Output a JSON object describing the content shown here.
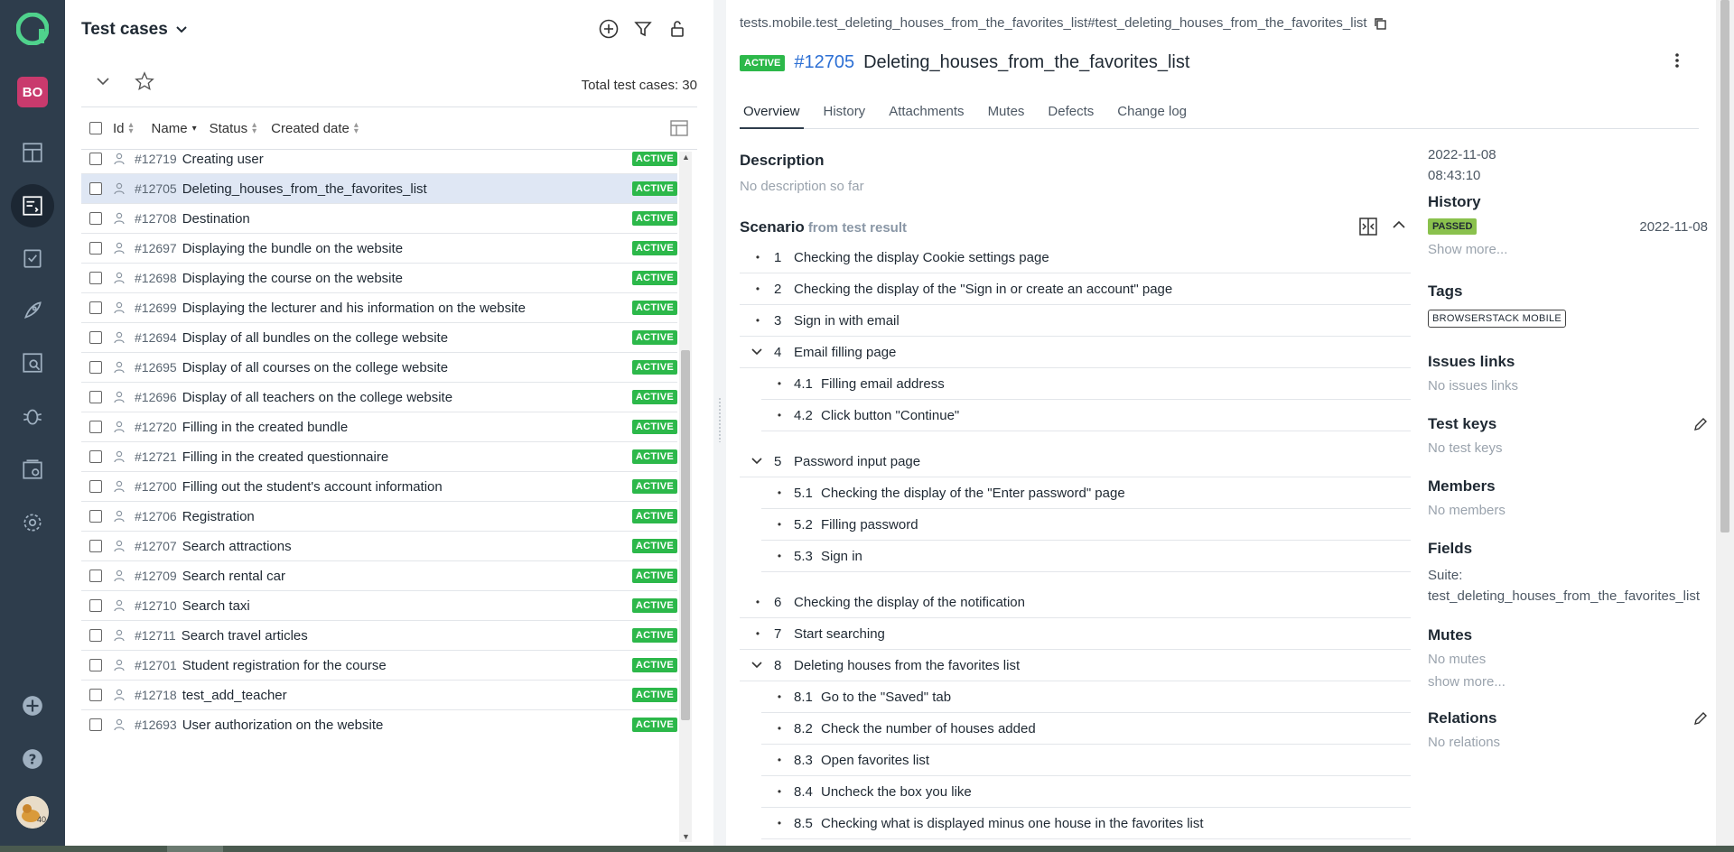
{
  "nav": {
    "workspace_initials": "BO",
    "user_badge": "40",
    "icons": [
      "allure-logo-icon",
      "dashboard-icon",
      "test-cases-icon",
      "test-plans-icon",
      "launches-icon",
      "analytics-icon",
      "defects-icon",
      "jobs-icon",
      "settings-icon",
      "add-project-icon",
      "help-icon"
    ]
  },
  "list": {
    "title": "Test cases",
    "total_label": "Total test cases: 30",
    "columns": {
      "id": "Id",
      "name": "Name",
      "status": "Status",
      "created": "Created date"
    },
    "rows": [
      {
        "id": "#12719",
        "name": "Creating user",
        "status": "ACTIVE"
      },
      {
        "id": "#12705",
        "name": "Deleting_houses_from_the_favorites_list",
        "status": "ACTIVE"
      },
      {
        "id": "#12708",
        "name": "Destination",
        "status": "ACTIVE"
      },
      {
        "id": "#12697",
        "name": "Displaying the bundle on the website",
        "status": "ACTIVE"
      },
      {
        "id": "#12698",
        "name": "Displaying the course on the website",
        "status": "ACTIVE"
      },
      {
        "id": "#12699",
        "name": "Displaying the lecturer and his information on the website",
        "status": "ACTIVE"
      },
      {
        "id": "#12694",
        "name": "Display of all bundles on the college website",
        "status": "ACTIVE"
      },
      {
        "id": "#12695",
        "name": "Display of all courses on the college website",
        "status": "ACTIVE"
      },
      {
        "id": "#12696",
        "name": "Display of all teachers on the college website",
        "status": "ACTIVE"
      },
      {
        "id": "#12720",
        "name": "Filling in the created bundle",
        "status": "ACTIVE"
      },
      {
        "id": "#12721",
        "name": "Filling in the created questionnaire",
        "status": "ACTIVE"
      },
      {
        "id": "#12700",
        "name": "Filling out the student's account information",
        "status": "ACTIVE"
      },
      {
        "id": "#12706",
        "name": "Registration",
        "status": "ACTIVE"
      },
      {
        "id": "#12707",
        "name": "Search attractions",
        "status": "ACTIVE"
      },
      {
        "id": "#12709",
        "name": "Search rental car",
        "status": "ACTIVE"
      },
      {
        "id": "#12710",
        "name": "Search taxi",
        "status": "ACTIVE"
      },
      {
        "id": "#12711",
        "name": "Search travel articles",
        "status": "ACTIVE"
      },
      {
        "id": "#12701",
        "name": "Student registration for the course",
        "status": "ACTIVE"
      },
      {
        "id": "#12718",
        "name": "test_add_teacher",
        "status": "ACTIVE"
      },
      {
        "id": "#12693",
        "name": "User authorization on the website",
        "status": "ACTIVE"
      }
    ]
  },
  "detail": {
    "path": "tests.mobile.test_deleting_houses_from_the_favorites_list#test_deleting_houses_from_the_favorites_list",
    "status": "ACTIVE",
    "id": "#12705",
    "name": "Deleting_houses_from_the_favorites_list",
    "tabs": [
      "Overview",
      "History",
      "Attachments",
      "Mutes",
      "Defects",
      "Change log"
    ],
    "description_title": "Description",
    "description_value": "No description so far",
    "scenario_title": "Scenario",
    "scenario_source": "from test result",
    "steps": [
      {
        "num": "1",
        "text": "Checking the display Cookie settings page"
      },
      {
        "num": "2",
        "text": "Checking the display of the \"Sign in or create an account\" page"
      },
      {
        "num": "3",
        "text": "Sign in with email"
      },
      {
        "num": "4",
        "text": "Email filling page"
      },
      {
        "num": "4.1",
        "text": "Filling email address"
      },
      {
        "num": "4.2",
        "text": "Click button \"Continue\""
      },
      {
        "num": "5",
        "text": "Password input page"
      },
      {
        "num": "5.1",
        "text": "Checking the display of the \"Enter password\" page"
      },
      {
        "num": "5.2",
        "text": "Filling password"
      },
      {
        "num": "5.3",
        "text": "Sign in"
      },
      {
        "num": "6",
        "text": "Checking the display of the notification"
      },
      {
        "num": "7",
        "text": "Start searching"
      },
      {
        "num": "8",
        "text": "Deleting houses from the favorites list"
      },
      {
        "num": "8.1",
        "text": "Go to the \"Saved\" tab"
      },
      {
        "num": "8.2",
        "text": "Check the number of houses added"
      },
      {
        "num": "8.3",
        "text": "Open favorites list"
      },
      {
        "num": "8.4",
        "text": "Uncheck the box you like"
      },
      {
        "num": "8.5",
        "text": "Checking what is displayed minus one house in the favorites list"
      }
    ],
    "side": {
      "created_date": "2022-11-08",
      "created_time": "08:43:10",
      "history_title": "History",
      "history_status": "PASSED",
      "history_date": "2022-11-08",
      "show_more": "Show more...",
      "tags_title": "Tags",
      "tag": "BROWSERSTACK MOBILE",
      "issues_title": "Issues links",
      "issues_value": "No issues links",
      "keys_title": "Test keys",
      "keys_value": "No test keys",
      "members_title": "Members",
      "members_value": "No members",
      "fields_title": "Fields",
      "fields_suite_label": "Suite:",
      "fields_suite_value": "test_deleting_houses_from_the_favorites_list",
      "mutes_title": "Mutes",
      "mutes_value": "No mutes",
      "mutes_more": "show more...",
      "relations_title": "Relations",
      "relations_value": "No relations"
    }
  },
  "colors": {
    "nav_bg": "#2e3d4c",
    "active_green": "#2cb84a",
    "passed_green": "#8ac14d",
    "link_blue": "#2c6fd4",
    "selected_row": "#dfe7f4"
  }
}
